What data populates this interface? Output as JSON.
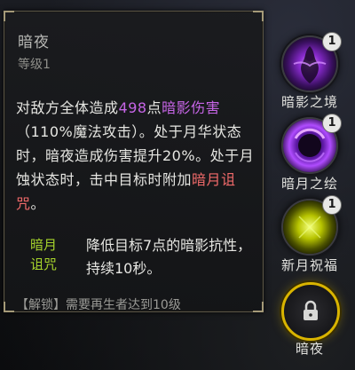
{
  "tooltip": {
    "title": "暗夜",
    "level": "等级1",
    "desc_1": "对敌方全体造成",
    "damage_value": "498",
    "desc_2": "点",
    "damage_type": "暗影伤害",
    "desc_3": "（110%魔法攻击）。处于月华状态时，暗夜造成伤害提升20%。处于月蚀状态时，击中目标时附加",
    "curse_name": "暗月诅咒",
    "desc_4": "。",
    "effect_tag": "暗月诅咒",
    "effect_desc": "降低目标7点的暗影抗性，持续10秒。",
    "unlock_text": "【解锁】需要再生者达到10级"
  },
  "skills": [
    {
      "label": "暗影之境",
      "badge": "1",
      "icon": "shadow-figure-icon",
      "color": "#9a3ad8"
    },
    {
      "label": "暗月之绘",
      "badge": "1",
      "icon": "dark-moon-icon",
      "color": "#8d2ee0"
    },
    {
      "label": "新月祝福",
      "badge": "1",
      "icon": "crescent-moon-icon",
      "color": "#d4e000"
    },
    {
      "label": "暗夜",
      "badge": "",
      "icon": "lock-icon",
      "color": "#d9b400"
    }
  ],
  "colors": {
    "shadow_purple": "#c665e6",
    "curse_red": "#f06a6a",
    "effect_green": "#a6d32c",
    "selected_gold": "#d9b400"
  }
}
